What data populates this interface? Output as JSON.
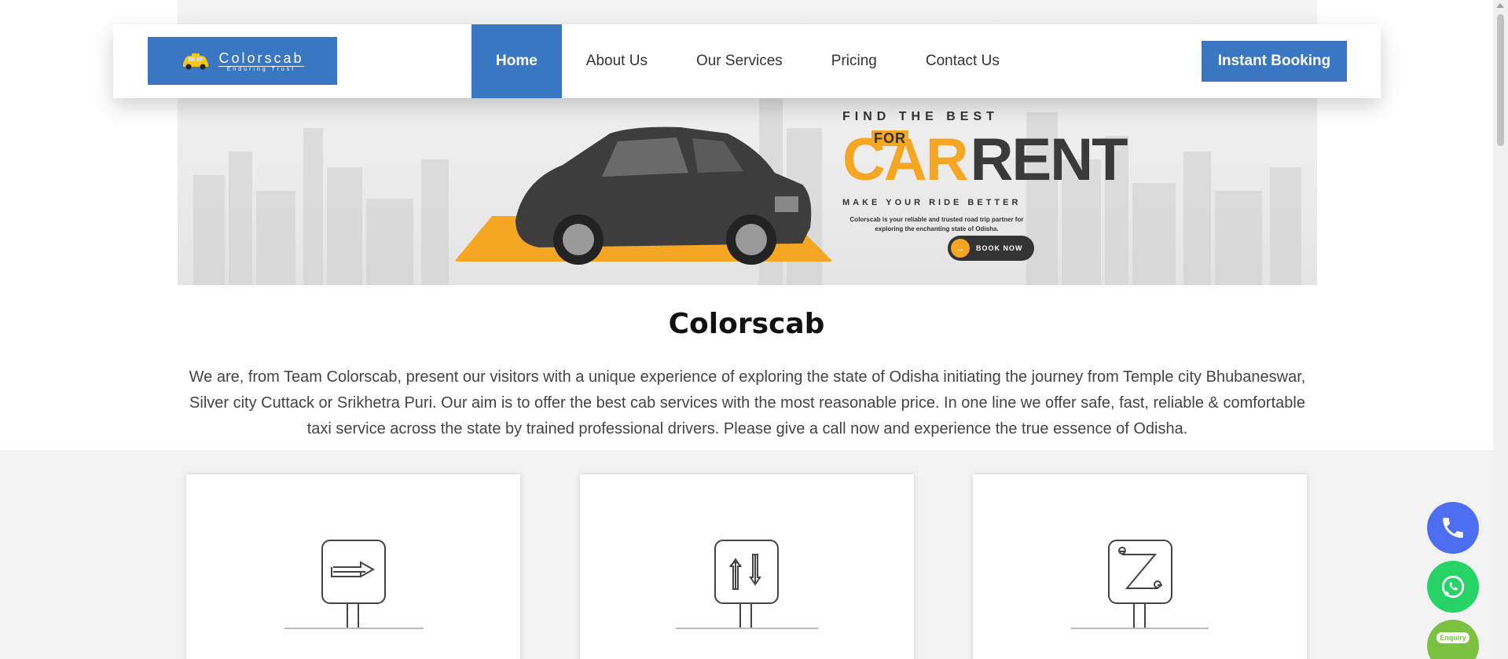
{
  "nav": {
    "logo_title": "Colorscab",
    "logo_subtitle": "Enduring Trust",
    "items": [
      {
        "label": "Home",
        "active": true
      },
      {
        "label": "About Us"
      },
      {
        "label": "Our Services"
      },
      {
        "label": "Pricing"
      },
      {
        "label": "Contact Us"
      }
    ],
    "cta_label": "Instant Booking"
  },
  "hero": {
    "line1": "FIND THE BEST",
    "for": "FOR",
    "car": "CAR",
    "rent": "RENT",
    "tagline": "MAKE YOUR RIDE BETTER",
    "description": "Colorscab is your reliable and trusted road trip partner for exploring the enchanting state of Odisha.",
    "book_label": "BOOK NOW"
  },
  "intro": {
    "title": "Colorscab",
    "text": "We are, from Team Colorscab, present our visitors with a unique experience of exploring the state of Odisha initiating the journey from Temple city Bhubaneswar, Silver city Cuttack or Srikhetra Puri. Our aim is to offer the best cab services with the most reasonable price. In one line we offer safe, fast, reliable & comfortable taxi service across the state by trained professional drivers. Please give a call now and experience the true essence of Odisha."
  },
  "features": [
    {
      "icon": "one-way-sign-icon"
    },
    {
      "icon": "round-trip-sign-icon"
    },
    {
      "icon": "multi-route-sign-icon"
    }
  ],
  "floating": {
    "enquiry_label": "Enquiry"
  },
  "colors": {
    "primary": "#3a77c2",
    "accent": "#f5a623",
    "phone": "#4e6ef2",
    "whatsapp": "#25d366"
  }
}
